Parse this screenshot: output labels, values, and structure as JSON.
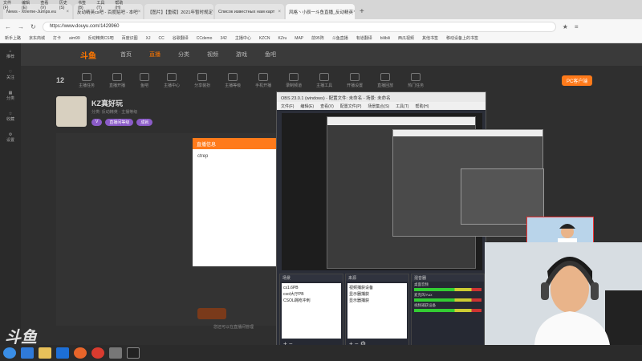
{
  "browser": {
    "menu": [
      "文件(F)",
      "编辑(E)",
      "查看(V)",
      "历史(S)",
      "书签(B)",
      "工具(T)",
      "帮助(H)"
    ],
    "tabs": [
      {
        "label": "News - Xtreme-Jumps.eu"
      },
      {
        "label": "反动精英cs吧 - 百度贴吧 - 本吧"
      },
      {
        "label": "【图片】【重磅】2021年暂时规定"
      },
      {
        "label": "Список известных нам карт"
      },
      {
        "label": "风格丶小辰一斗鱼直播_反动精英"
      }
    ],
    "address": "https://www.douyu.com/1429960",
    "bookmarks": [
      "新手上路",
      "京东商城",
      "打卡",
      "aim99",
      "反动精英CS吧",
      "百度识图",
      "XJ",
      "CC",
      "谷歌翻译",
      "CCdemo",
      "342",
      "主播中心",
      "KZCN",
      "KZru",
      "MAP",
      "前95阵",
      "斗鱼直播",
      "有道翻译",
      "bilibili",
      "西瓜视频",
      "其他书签",
      "移动设备上的书签"
    ]
  },
  "site": {
    "logo": "斗鱼",
    "nav": [
      "首页",
      "直播",
      "分类",
      "视频",
      "游戏",
      "鱼吧"
    ],
    "active_nav": "直播",
    "sidebar": [
      "推荐",
      "关注",
      "分类",
      "收藏",
      "设置"
    ],
    "follow_count": "12",
    "pc_button": "PC客户端",
    "categories": [
      "主播任务",
      "直播开播",
      "鱼吧",
      "主播中心",
      "分享装扮",
      "主播等级",
      "手机开播",
      "录制频道",
      "主播工具",
      "开播设置",
      "直播回放",
      "热门任务"
    ],
    "streamer": {
      "name": "KZ真好玩",
      "meta": "分类: 反动精英 · 主播等级",
      "badges": [
        "V",
        "直播间等级",
        "成就"
      ]
    },
    "popup": {
      "title": "直播信息",
      "body": "ctrep"
    },
    "footnote": "您还可以在直播间管理"
  },
  "obs": {
    "title": "OBS 23.0.1 (windows) - 配置文件: 未命名 - 场景: 未命名",
    "menu": [
      "文件(F)",
      "编辑(E)",
      "查看(V)",
      "配置文件(P)",
      "场景集合(S)",
      "工具(T)",
      "帮助(H)"
    ],
    "panels": {
      "scenes": {
        "title": "场景",
        "items": [
          "cs1.6PB",
          "csol大厅PB",
          "CSOL跳枪冲刺"
        ]
      },
      "sources": {
        "title": "来源",
        "items": [
          "视频捕获设备",
          "显示器捕获",
          "显示器捕获"
        ]
      },
      "mixer": {
        "title": "混音器",
        "items": [
          "桌面音频",
          "麦克风/Aux",
          "视频捕获设备"
        ]
      }
    }
  },
  "overlay": {
    "watermark": "斗鱼"
  }
}
